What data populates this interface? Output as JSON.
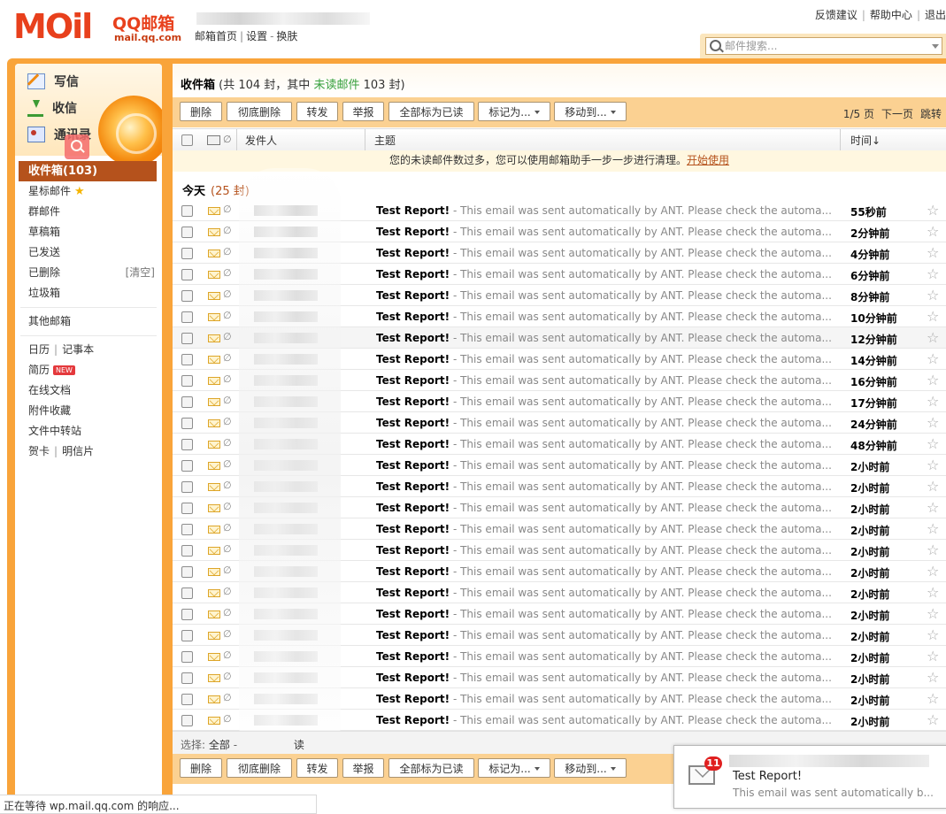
{
  "header": {
    "logo_mail": "MOil",
    "logo_qq": "QQ邮箱",
    "logo_url": "mail.qq.com",
    "links": [
      "邮箱首页",
      "设置",
      "换肤"
    ],
    "right_links": [
      "反馈建议",
      "帮助中心",
      "退出"
    ],
    "search_placeholder": "邮件搜索..."
  },
  "sidebar": {
    "actions": [
      {
        "label": "写信",
        "icon": "pencil-icon"
      },
      {
        "label": "收信",
        "icon": "inbox-download-icon"
      },
      {
        "label": "通讯录",
        "icon": "contacts-icon"
      }
    ],
    "folders": [
      {
        "label": "收件箱(103)",
        "active": true
      },
      {
        "label": "星标邮件",
        "star": "★"
      },
      {
        "label": "群邮件"
      },
      {
        "label": "草稿箱"
      },
      {
        "label": "已发送"
      },
      {
        "label": "已删除",
        "extra": "[清空]"
      },
      {
        "label": "垃圾箱"
      }
    ],
    "other": "其他邮箱",
    "tools": {
      "calendar": "日历",
      "notes": "记事本",
      "resume": "简历",
      "new_badge": "NEW",
      "docs": "在线文档",
      "attach": "附件收藏",
      "transfer": "文件中转站",
      "card": "贺卡",
      "postcard": "明信片"
    }
  },
  "main": {
    "title_folder": "收件箱",
    "title_pre": " (共 104 封，其中 ",
    "title_unread_label": "未读邮件",
    "title_post": " 103 封)",
    "toolbar": {
      "delete": "删除",
      "purge": "彻底删除",
      "forward": "转发",
      "report": "举报",
      "mark_all_read": "全部标为已读",
      "mark_as": "标记为...",
      "move_to": "移动到..."
    },
    "pager": {
      "page": "1/5 页",
      "next": "下一页",
      "jump": "跳转"
    },
    "columns": {
      "sender": "发件人",
      "subject": "主题",
      "time": "时间↓"
    },
    "notice_text": "您的未读邮件数过多，您可以使用邮箱助手一步一步进行清理。",
    "notice_link": "开始使用",
    "group_label": "今天",
    "group_count": "(25 封)",
    "select_label": "选择:",
    "select_all": "全部",
    "select_tail": "读",
    "emails": [
      {
        "subject": "Test Report!",
        "preview": " - This email was sent automatically by ANT. Please check the automa...",
        "time": "55秒前"
      },
      {
        "subject": "Test Report!",
        "preview": " - This email was sent automatically by ANT. Please check the automa...",
        "time": "2分钟前"
      },
      {
        "subject": "Test Report!",
        "preview": " - This email was sent automatically by ANT. Please check the automa...",
        "time": "4分钟前"
      },
      {
        "subject": "Test Report!",
        "preview": " - This email was sent automatically by ANT. Please check the automa...",
        "time": "6分钟前"
      },
      {
        "subject": "Test Report!",
        "preview": " - This email was sent automatically by ANT. Please check the automa...",
        "time": "8分钟前"
      },
      {
        "subject": "Test Report!",
        "preview": " - This email was sent automatically by ANT. Please check the automa...",
        "time": "10分钟前"
      },
      {
        "subject": "Test Report!",
        "preview": " - This email was sent automatically by ANT. Please check the automa...",
        "time": "12分钟前",
        "highlight": true
      },
      {
        "subject": "Test Report!",
        "preview": " - This email was sent automatically by ANT. Please check the automa...",
        "time": "14分钟前"
      },
      {
        "subject": "Test Report!",
        "preview": " - This email was sent automatically by ANT. Please check the automa...",
        "time": "16分钟前"
      },
      {
        "subject": "Test Report!",
        "preview": " - This email was sent automatically by ANT. Please check the automa...",
        "time": "17分钟前"
      },
      {
        "subject": "Test Report!",
        "preview": " - This email was sent automatically by ANT. Please check the automa...",
        "time": "24分钟前"
      },
      {
        "subject": "Test Report!",
        "preview": " - This email was sent automatically by ANT. Please check the automa...",
        "time": "48分钟前"
      },
      {
        "subject": "Test Report!",
        "preview": " - This email was sent automatically by ANT. Please check the automa...",
        "time": "2小时前"
      },
      {
        "subject": "Test Report!",
        "preview": " - This email was sent automatically by ANT. Please check the automa...",
        "time": "2小时前"
      },
      {
        "subject": "Test Report!",
        "preview": " - This email was sent automatically by ANT. Please check the automa...",
        "time": "2小时前"
      },
      {
        "subject": "Test Report!",
        "preview": " - This email was sent automatically by ANT. Please check the automa...",
        "time": "2小时前"
      },
      {
        "subject": "Test Report!",
        "preview": " - This email was sent automatically by ANT. Please check the automa...",
        "time": "2小时前"
      },
      {
        "subject": "Test Report!",
        "preview": " - This email was sent automatically by ANT. Please check the automa...",
        "time": "2小时前"
      },
      {
        "subject": "Test Report!",
        "preview": " - This email was sent automatically by ANT. Please check the automa...",
        "time": "2小时前"
      },
      {
        "subject": "Test Report!",
        "preview": " - This email was sent automatically by ANT. Please check the automa...",
        "time": "2小时前"
      },
      {
        "subject": "Test Report!",
        "preview": " - This email was sent automatically by ANT. Please check the automa...",
        "time": "2小时前"
      },
      {
        "subject": "Test Report!",
        "preview": " - This email was sent automatically by ANT. Please check the automa...",
        "time": "2小时前"
      },
      {
        "subject": "Test Report!",
        "preview": " - This email was sent automatically by ANT. Please check the automa...",
        "time": "2小时前"
      },
      {
        "subject": "Test Report!",
        "preview": " - This email was sent automatically by ANT. Please check the automa...",
        "time": "2小时前"
      },
      {
        "subject": "Test Report!",
        "preview": " - This email was sent automatically by ANT. Please check the automa...",
        "time": "2小时前"
      }
    ]
  },
  "status_text": "正在等待 wp.mail.qq.com 的响应...",
  "popup": {
    "badge": "11",
    "title": "Test Report!",
    "body": "This email was sent automatically b..."
  },
  "colors": {
    "frame": "#f9a43a",
    "toolbar": "#fbd192",
    "active_folder": "#b5521c",
    "unread_green": "#36a03d"
  }
}
